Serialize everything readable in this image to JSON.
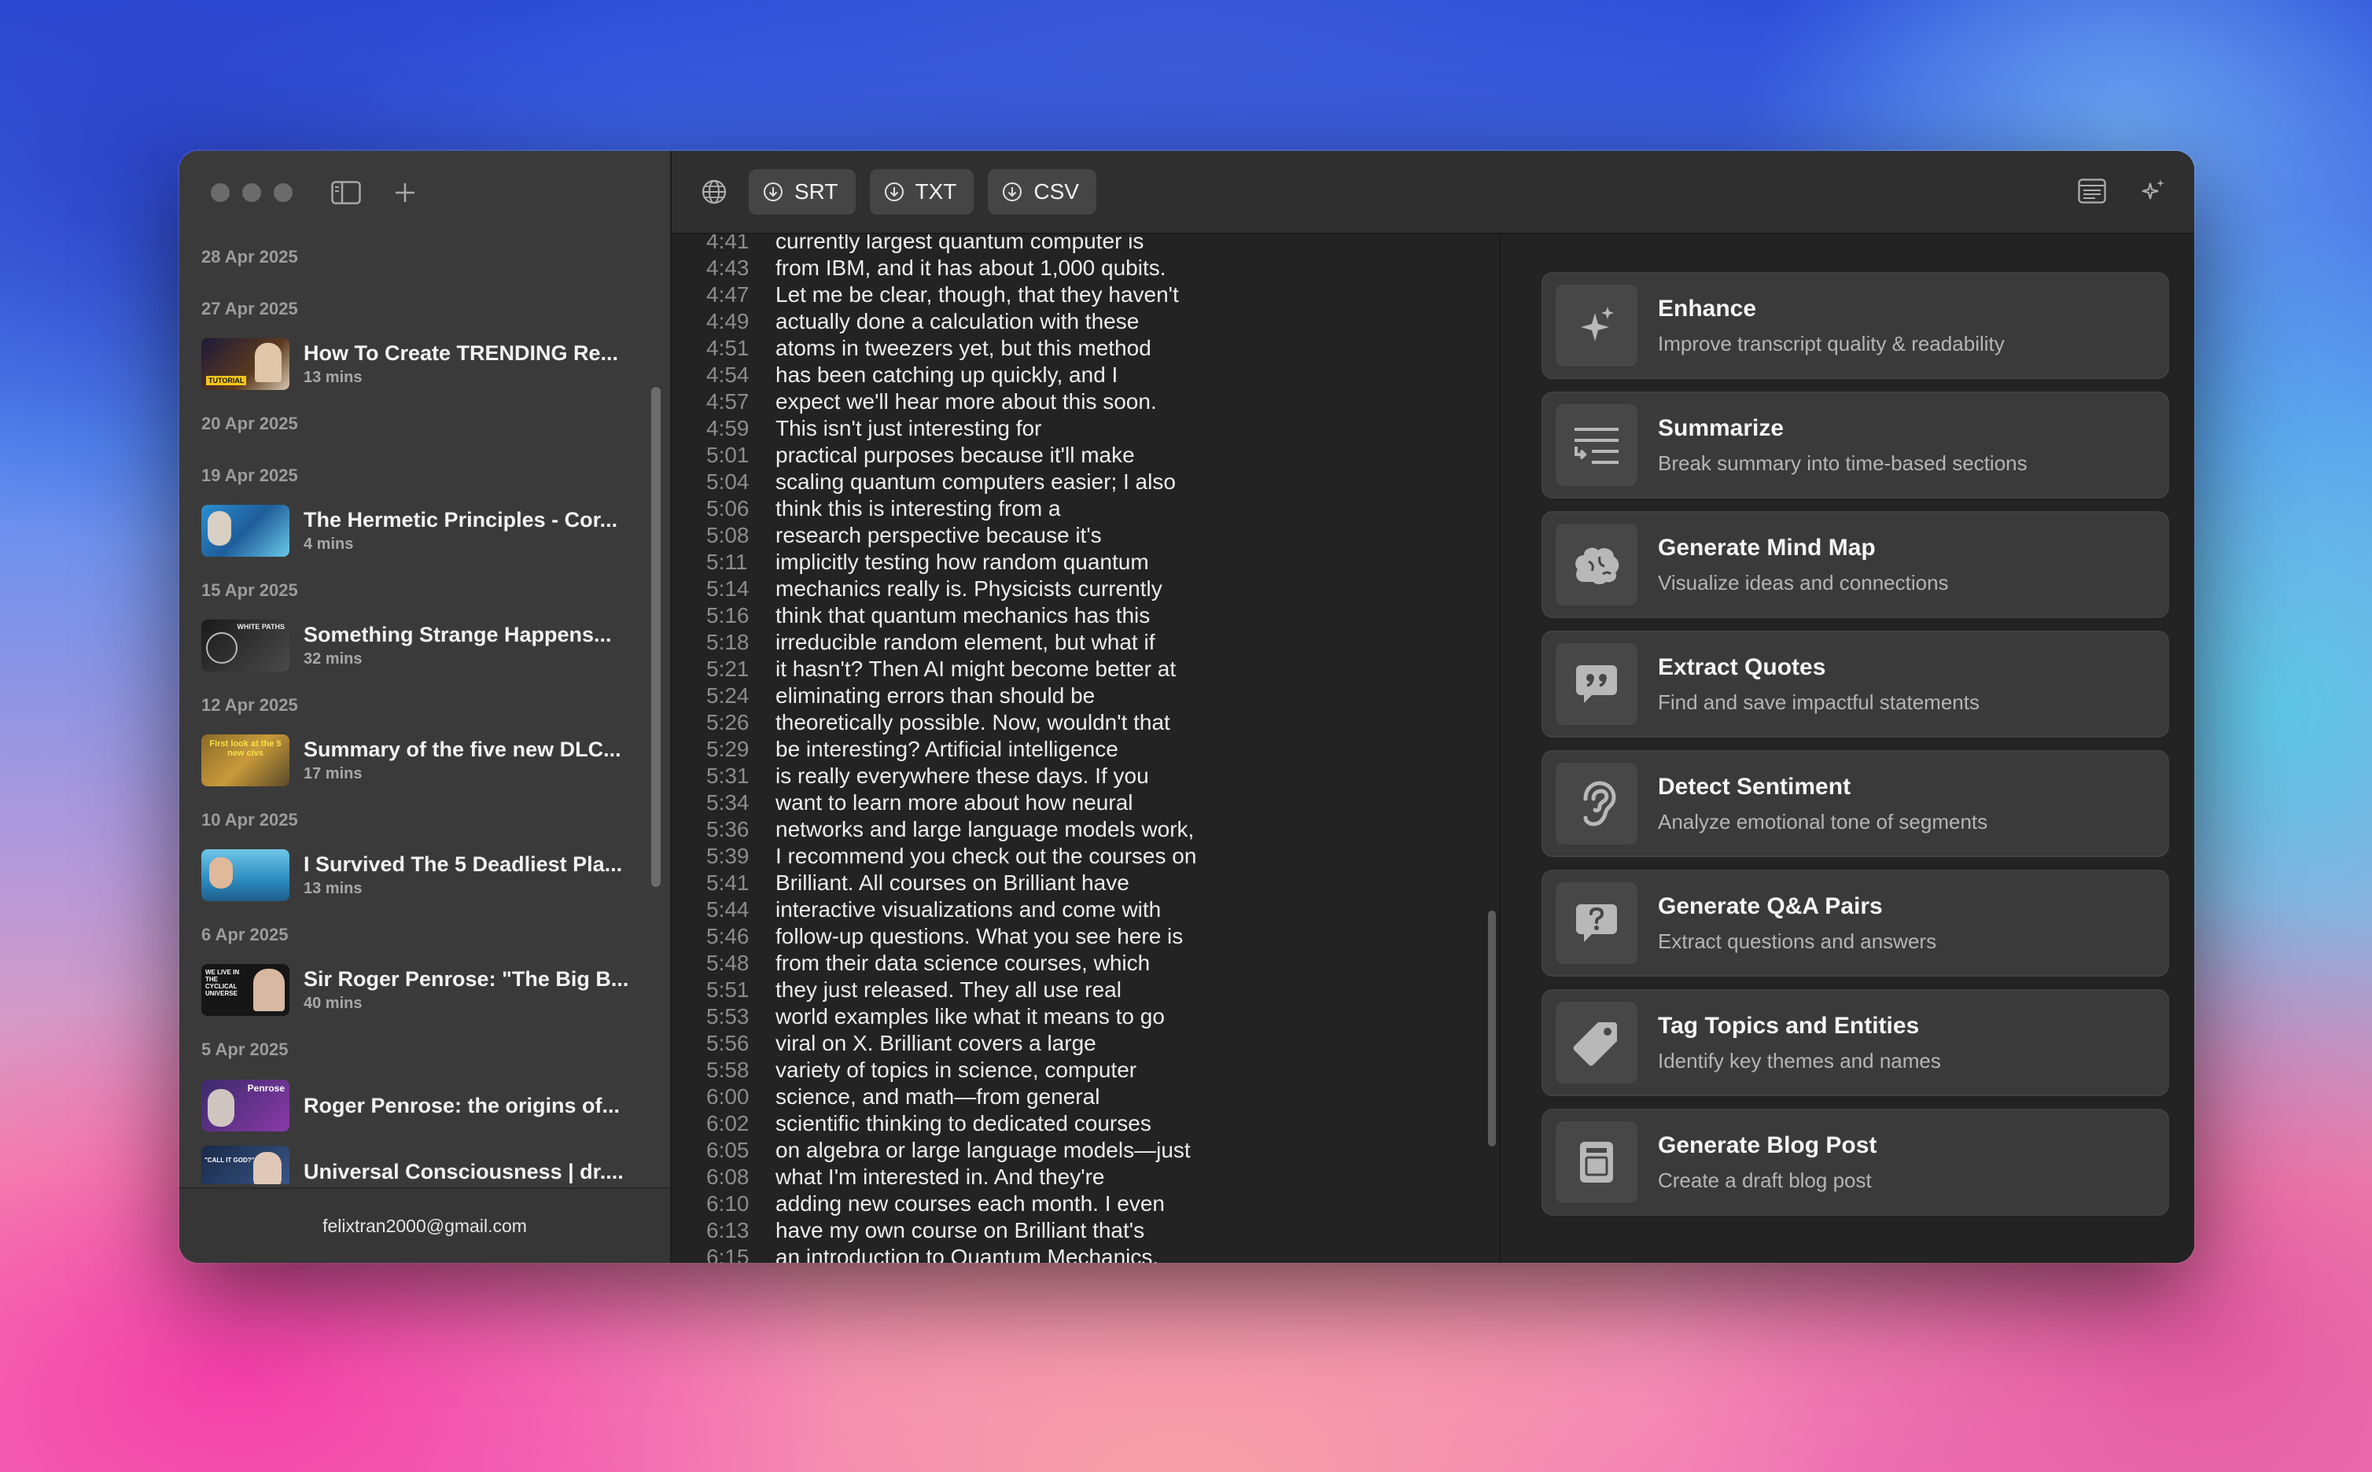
{
  "sidebar": {
    "groups": [
      {
        "date": "28 Apr 2025",
        "items": []
      },
      {
        "date": "27 Apr 2025",
        "items": [
          {
            "title": "How To Create TRENDING Re...",
            "duration": "13 mins",
            "thumb_color": "#3a2c1f"
          }
        ]
      },
      {
        "date": "20 Apr 2025",
        "items": []
      },
      {
        "date": "19 Apr 2025",
        "items": [
          {
            "title": "The Hermetic Principles - Cor...",
            "duration": "4 mins",
            "thumb_color": "#2a7fb8"
          }
        ]
      },
      {
        "date": "15 Apr 2025",
        "items": [
          {
            "title": "Something Strange Happens...",
            "duration": "32 mins",
            "thumb_color": "#1b1b1b"
          }
        ]
      },
      {
        "date": "12 Apr 2025",
        "items": [
          {
            "title": "Summary of the five new DLC...",
            "duration": "17 mins",
            "thumb_color": "#b58a2b"
          }
        ]
      },
      {
        "date": "10 Apr 2025",
        "items": [
          {
            "title": "I Survived The 5 Deadliest Pla...",
            "duration": "13 mins",
            "thumb_color": "#3f9fc6"
          }
        ]
      },
      {
        "date": "6 Apr 2025",
        "items": [
          {
            "title": "Sir Roger Penrose: \"The Big B...",
            "duration": "40 mins",
            "thumb_color": "#141414"
          }
        ]
      },
      {
        "date": "5 Apr 2025",
        "items": [
          {
            "title": "Roger Penrose: the origins of...",
            "duration": "",
            "thumb_color": "#6a3ba0"
          },
          {
            "title": "Universal Consciousness | dr....",
            "duration": "",
            "thumb_color": "#2b3f6a"
          }
        ]
      }
    ],
    "thumb_texts": {
      "thumb1": "TUTORIAL",
      "thumb3": "WHITE PATHS",
      "thumb4": "First look at the 5 new civs",
      "thumb6": "WE LIVE IN THE CYCLICAL UNIVERSE",
      "thumb7": "Penrose",
      "thumb8": "\"CALL IT GOD?\""
    },
    "email": "felixtran2000@gmail.com"
  },
  "toolbar": {
    "buttons": [
      {
        "label": "SRT",
        "icon": "download-icon"
      },
      {
        "label": "TXT",
        "icon": "download-icon"
      },
      {
        "label": "CSV",
        "icon": "download-icon"
      }
    ]
  },
  "transcript": [
    {
      "t": "4:41",
      "text": "currently largest quantum computer is"
    },
    {
      "t": "4:43",
      "text": "from IBM, and it has about 1,000 qubits."
    },
    {
      "t": "4:47",
      "text": "Let me be clear, though, that they haven't"
    },
    {
      "t": "4:49",
      "text": "actually done a calculation with these"
    },
    {
      "t": "4:51",
      "text": "atoms in tweezers yet, but this method"
    },
    {
      "t": "4:54",
      "text": "has been catching up quickly, and I"
    },
    {
      "t": "4:57",
      "text": "expect we'll hear more about this soon."
    },
    {
      "t": "4:59",
      "text": "This isn't just interesting for"
    },
    {
      "t": "5:01",
      "text": "practical purposes because it'll make"
    },
    {
      "t": "5:04",
      "text": "scaling quantum computers easier; I also"
    },
    {
      "t": "5:06",
      "text": "think this is interesting from a"
    },
    {
      "t": "5:08",
      "text": "research perspective because it's"
    },
    {
      "t": "5:11",
      "text": "implicitly testing how random quantum"
    },
    {
      "t": "5:14",
      "text": "mechanics really is. Physicists currently"
    },
    {
      "t": "5:16",
      "text": "think that quantum mechanics has this"
    },
    {
      "t": "5:18",
      "text": "irreducible random element, but what if"
    },
    {
      "t": "5:21",
      "text": "it hasn't? Then AI might become better at"
    },
    {
      "t": "5:24",
      "text": "eliminating errors than should be"
    },
    {
      "t": "5:26",
      "text": "theoretically possible. Now, wouldn't that"
    },
    {
      "t": "5:29",
      "text": "be interesting? Artificial intelligence"
    },
    {
      "t": "5:31",
      "text": "is really everywhere these days. If you"
    },
    {
      "t": "5:34",
      "text": "want to learn more about how neural"
    },
    {
      "t": "5:36",
      "text": "networks and large language models work,"
    },
    {
      "t": "5:39",
      "text": "I recommend you check out the courses on"
    },
    {
      "t": "5:41",
      "text": "Brilliant. All courses on Brilliant have"
    },
    {
      "t": "5:44",
      "text": "interactive visualizations and come with"
    },
    {
      "t": "5:46",
      "text": "follow-up questions. What you see here is"
    },
    {
      "t": "5:48",
      "text": "from their data science courses, which"
    },
    {
      "t": "5:51",
      "text": "they just released. They all use real"
    },
    {
      "t": "5:53",
      "text": "world examples like what it means to go"
    },
    {
      "t": "5:56",
      "text": "viral on X. Brilliant covers a large"
    },
    {
      "t": "5:58",
      "text": "variety of topics in science, computer"
    },
    {
      "t": "6:00",
      "text": "science, and math—from general"
    },
    {
      "t": "6:02",
      "text": "scientific thinking to dedicated courses"
    },
    {
      "t": "6:05",
      "text": "on algebra or large language models—just"
    },
    {
      "t": "6:08",
      "text": "what I'm interested in. And they're"
    },
    {
      "t": "6:10",
      "text": "adding new courses each month. I even"
    },
    {
      "t": "6:13",
      "text": "have my own course on Brilliant that's"
    },
    {
      "t": "6:15",
      "text": "an introduction to Quantum Mechanics."
    }
  ],
  "actions": [
    {
      "title": "Enhance",
      "subtitle": "Improve transcript quality & readability",
      "icon": "sparkles-icon"
    },
    {
      "title": "Summarize",
      "subtitle": "Break summary into time-based sections",
      "icon": "summary-lines-icon"
    },
    {
      "title": "Generate Mind Map",
      "subtitle": "Visualize ideas and connections",
      "icon": "brain-icon"
    },
    {
      "title": "Extract Quotes",
      "subtitle": "Find and save impactful statements",
      "icon": "quote-bubble-icon"
    },
    {
      "title": "Detect Sentiment",
      "subtitle": "Analyze emotional tone of segments",
      "icon": "ear-icon"
    },
    {
      "title": "Generate Q&A Pairs",
      "subtitle": "Extract questions and answers",
      "icon": "question-bubble-icon"
    },
    {
      "title": "Tag Topics and Entities",
      "subtitle": "Identify key themes and names",
      "icon": "tag-icon"
    },
    {
      "title": "Generate Blog Post",
      "subtitle": "Create a draft blog post",
      "icon": "document-icon"
    }
  ]
}
